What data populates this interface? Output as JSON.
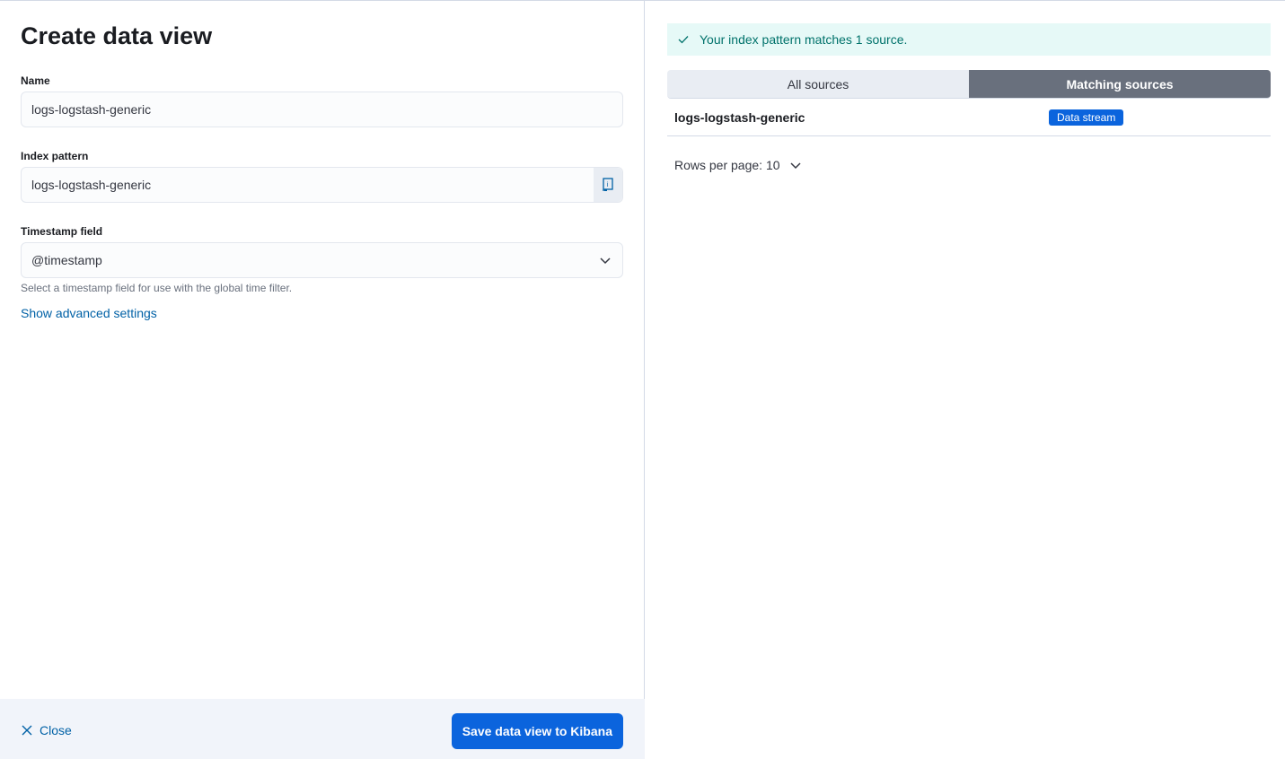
{
  "title": "Create data view",
  "name": {
    "label": "Name",
    "value": "logs-logstash-generic"
  },
  "index_pattern": {
    "label": "Index pattern",
    "value": "logs-logstash-generic"
  },
  "timestamp": {
    "label": "Timestamp field",
    "value": "@timestamp",
    "help": "Select a timestamp field for use with the global time filter."
  },
  "advanced_link": "Show advanced settings",
  "footer": {
    "close": "Close",
    "save": "Save data view to Kibana"
  },
  "callout": "Your index pattern matches 1 source.",
  "tabs": [
    {
      "label": "All sources"
    },
    {
      "label": "Matching sources"
    }
  ],
  "rows": [
    {
      "name": "logs-logstash-generic",
      "badge": "Data stream"
    }
  ],
  "rows_per_page": "Rows per page: 10"
}
